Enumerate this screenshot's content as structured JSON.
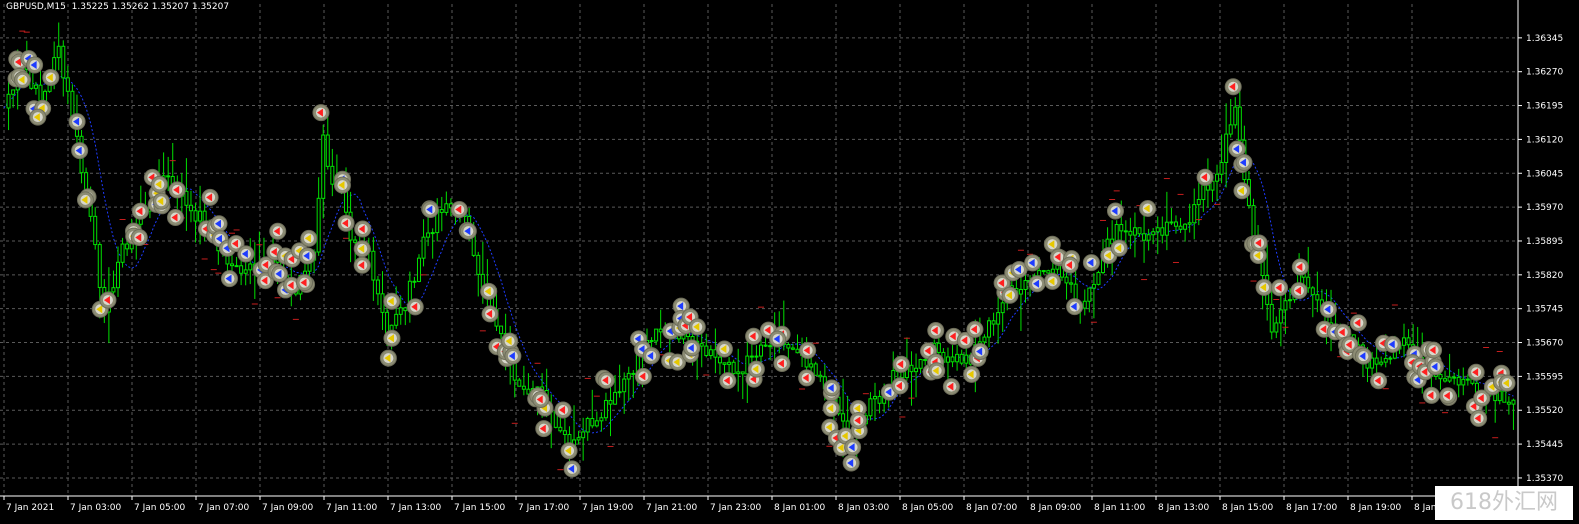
{
  "header": {
    "symbol": "GBPUSD,M15",
    "quote": "1.35225 1.35262 1.35207 1.35207"
  },
  "watermark": "618外汇网",
  "colors": {
    "background": "#000000",
    "grid": "#5a5a5a",
    "candle": "#00e000",
    "ma_line": "#1e3cff",
    "marker_ring": "#8c8c74",
    "buy_arrow": "#1e3cff",
    "sell_arrow": "#ff2020",
    "close_check": "#e6c800",
    "level_dash": "#c81e1e",
    "axis_text": "#ffffff"
  },
  "chart_data": {
    "type": "candlestick",
    "title": "",
    "xlabel": "",
    "ylabel": "",
    "ylim": [
      1.3533,
      1.3642
    ],
    "y_ticks": [
      1.36345,
      1.3627,
      1.36195,
      1.3612,
      1.36045,
      1.3597,
      1.35895,
      1.3582,
      1.35745,
      1.3567,
      1.35595,
      1.3552,
      1.35445,
      1.3537
    ],
    "x_ticks": [
      "7 Jan 2021",
      "7 Jan 03:00",
      "7 Jan 05:00",
      "7 Jan 07:00",
      "7 Jan 09:00",
      "7 Jan 11:00",
      "7 Jan 13:00",
      "7 Jan 15:00",
      "7 Jan 17:00",
      "7 Jan 19:00",
      "7 Jan 21:00",
      "7 Jan 23:00",
      "8 Jan 01:00",
      "8 Jan 03:00",
      "8 Jan 05:00",
      "8 Jan 07:00",
      "8 Jan 09:00",
      "8 Jan 11:00",
      "8 Jan 13:00",
      "8 Jan 15:00",
      "8 Jan 17:00",
      "8 Jan 19:00",
      "8 Jan 21:00"
    ],
    "anchors": [
      [
        0,
        1.3619
      ],
      [
        4,
        1.363
      ],
      [
        8,
        1.362
      ],
      [
        12,
        1.3632
      ],
      [
        15,
        1.3618
      ],
      [
        18,
        1.36
      ],
      [
        20,
        1.359
      ],
      [
        22,
        1.3572
      ],
      [
        25,
        1.3585
      ],
      [
        30,
        1.3595
      ],
      [
        35,
        1.3605
      ],
      [
        40,
        1.3598
      ],
      [
        45,
        1.3592
      ],
      [
        50,
        1.3583
      ],
      [
        55,
        1.3585
      ],
      [
        60,
        1.3584
      ],
      [
        64,
        1.3578
      ],
      [
        68,
        1.3588
      ],
      [
        70,
        1.3612
      ],
      [
        72,
        1.3603
      ],
      [
        74,
        1.36
      ],
      [
        76,
        1.3588
      ],
      [
        80,
        1.3587
      ],
      [
        84,
        1.357
      ],
      [
        88,
        1.3575
      ],
      [
        92,
        1.359
      ],
      [
        96,
        1.3596
      ],
      [
        100,
        1.3597
      ],
      [
        104,
        1.3584
      ],
      [
        108,
        1.357
      ],
      [
        112,
        1.356
      ],
      [
        118,
        1.3555
      ],
      [
        124,
        1.3545
      ],
      [
        130,
        1.3551
      ],
      [
        136,
        1.3559
      ],
      [
        142,
        1.3568
      ],
      [
        150,
        1.357
      ],
      [
        160,
        1.356
      ],
      [
        170,
        1.3568
      ],
      [
        180,
        1.3557
      ],
      [
        186,
        1.3545
      ],
      [
        190,
        1.3553
      ],
      [
        196,
        1.356
      ],
      [
        204,
        1.3565
      ],
      [
        212,
        1.3563
      ],
      [
        220,
        1.3578
      ],
      [
        230,
        1.3585
      ],
      [
        236,
        1.3575
      ],
      [
        244,
        1.3593
      ],
      [
        252,
        1.359
      ],
      [
        260,
        1.3595
      ],
      [
        266,
        1.3605
      ],
      [
        270,
        1.3618
      ],
      [
        274,
        1.359
      ],
      [
        278,
        1.357
      ],
      [
        284,
        1.3582
      ],
      [
        292,
        1.357
      ],
      [
        300,
        1.3562
      ],
      [
        306,
        1.3567
      ],
      [
        314,
        1.356
      ],
      [
        322,
        1.3558
      ],
      [
        330,
        1.3555
      ]
    ]
  }
}
